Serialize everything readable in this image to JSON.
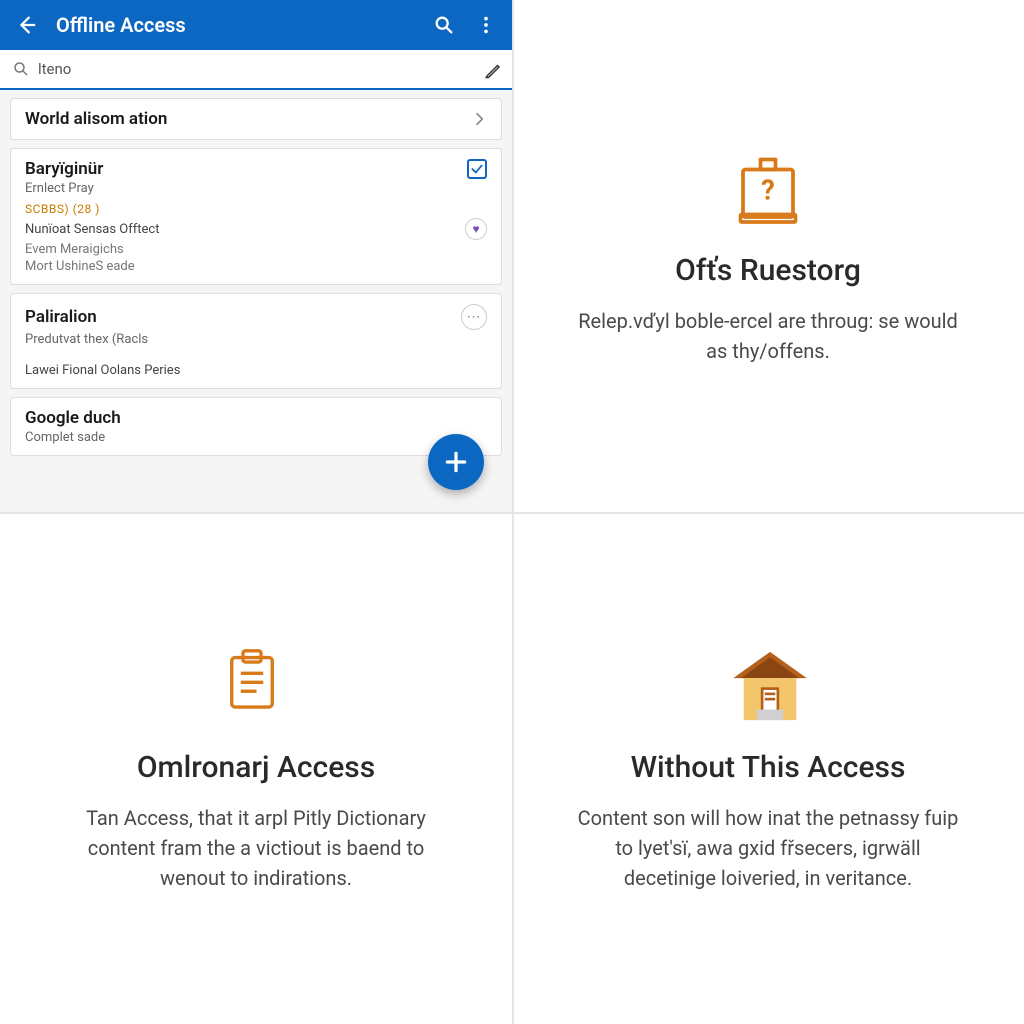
{
  "app": {
    "title": "Offline Access",
    "search_value": "lteno",
    "items": [
      {
        "title": "World alisom ation"
      },
      {
        "title": "Baryïginür",
        "subtitle": "Ernlect Pray",
        "qualifier": "SCBBS) (28 )",
        "lines": [
          "Nunïoat Sensas Offtect",
          "Evem Meraigichs",
          "Mort UshineS eade"
        ]
      },
      {
        "title": "Paliralion",
        "subtitle": "Predutvat thex (Racls",
        "extra": "Lawei Fional Oolans Peries"
      },
      {
        "title": "Google duch",
        "subtitle": "Complet sade"
      }
    ]
  },
  "features": {
    "a": {
      "title": "Ofťs Ruestorg",
      "body": "Relep.vďyl boble-ercel are throug: se would as thy/offens."
    },
    "b": {
      "title": "Omlronarj Access",
      "body": "Tan Access, that it arpl Pitly Dictionary content fram the a victiout is baend to wenout to indirations."
    },
    "c": {
      "title": "Without This Access",
      "body": "Content son will how inat the petnassy fuip to lyet'sï, awa gxid fřsecers, igrwäll decetinige loiveried, in veritance."
    }
  },
  "colors": {
    "primary": "#0b67c2",
    "accent": "#d97a1a"
  }
}
